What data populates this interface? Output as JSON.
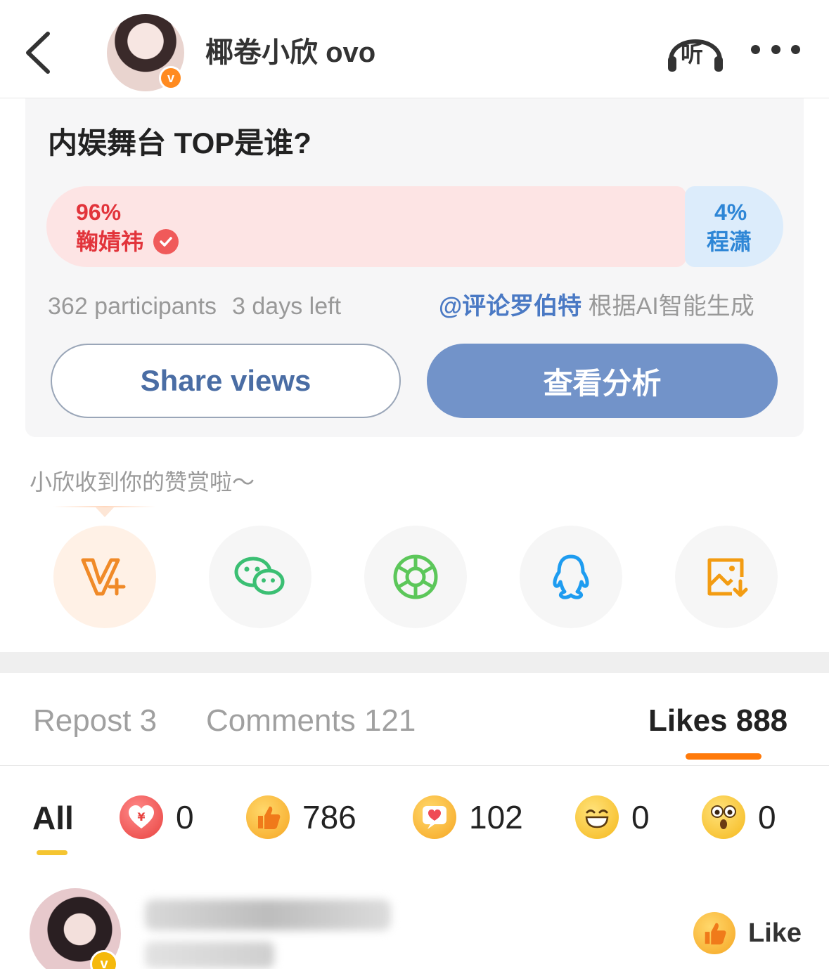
{
  "header": {
    "username": "椰卷小欣 ovo",
    "avatar_badge": "v",
    "listen_label": "听"
  },
  "poll": {
    "question": "内娱舞台 TOP是谁?",
    "option_a": {
      "percent": "96%",
      "name": "鞠婧祎",
      "share": 0.96,
      "color": "#e2343b"
    },
    "option_b": {
      "percent": "4%",
      "name": "程潇",
      "share": 0.04,
      "color": "#2e86d6"
    },
    "participants": "362 participants",
    "time_left": "3 days left",
    "ai_mention": "@评论罗伯特",
    "ai_note": "根据AI智能生成",
    "share_button": "Share views",
    "analysis_button": "查看分析"
  },
  "reward_text": "小欣收到你的赞赏啦～",
  "share_icons": [
    "vplus-icon",
    "wechat-icon",
    "moments-icon",
    "qq-icon",
    "save-image-icon"
  ],
  "tabs": {
    "repost": "Repost 3",
    "comments": "Comments 121",
    "likes": "Likes 888",
    "active": "likes",
    "accent": "#ff7a0a"
  },
  "reactions": {
    "all_label": "All",
    "items": [
      {
        "icon": "reward-heart-icon",
        "count": "0"
      },
      {
        "icon": "thumbs-up-icon",
        "count": "786"
      },
      {
        "icon": "heart-bubble-icon",
        "count": "102"
      },
      {
        "icon": "laugh-icon",
        "count": "0"
      },
      {
        "icon": "surprised-icon",
        "count": "0"
      }
    ]
  },
  "liker": {
    "badge": "v",
    "like_label": "Like"
  }
}
